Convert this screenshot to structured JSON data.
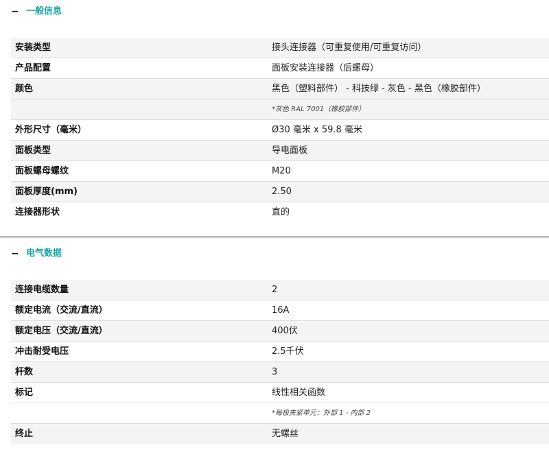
{
  "section1": {
    "toggle": "−",
    "title": "一般信息",
    "rows": [
      {
        "label": "安装类型",
        "value": "接头连接器（可重复使用/可重复访问）",
        "note": ""
      },
      {
        "label": "产品配置",
        "value": "面板安装连接器（后螺母）",
        "note": ""
      },
      {
        "label": "颜色",
        "value": "黑色（塑料部件） - 科技绿 - 灰色 - 黑色（橡胶部件）",
        "note": ""
      },
      {
        "label": "",
        "value": "",
        "note": "*灰色 RAL 7001（橡胶部件）"
      },
      {
        "label": "外形尺寸（毫米）",
        "value": "Ø30 毫米 x 59.8 毫米",
        "note": ""
      },
      {
        "label": "面板类型",
        "value": "导电面板",
        "note": ""
      },
      {
        "label": "面板螺母螺纹",
        "value": "M20",
        "note": ""
      },
      {
        "label": "面板厚度(mm)",
        "value": "2.50",
        "note": ""
      },
      {
        "label": "连接器形状",
        "value": "直的",
        "note": ""
      }
    ]
  },
  "section2": {
    "toggle": "−",
    "title": "电气数据",
    "rows": [
      {
        "label": "连接电缆数量",
        "value": "2",
        "note": ""
      },
      {
        "label": "额定电流（交流/直流）",
        "value": "16A",
        "note": ""
      },
      {
        "label": "额定电压（交流/直流）",
        "value": "400伏",
        "note": ""
      },
      {
        "label": "冲击耐受电压",
        "value": "2.5千伏",
        "note": ""
      },
      {
        "label": "杆数",
        "value": "3",
        "note": ""
      },
      {
        "label": "标记",
        "value": "线性相关函数",
        "note": ""
      },
      {
        "label": "",
        "value": "",
        "note": "*每极夹紧单元：外部 1 - 内部 2"
      },
      {
        "label": "终止",
        "value": "无螺丝",
        "note": ""
      }
    ]
  }
}
